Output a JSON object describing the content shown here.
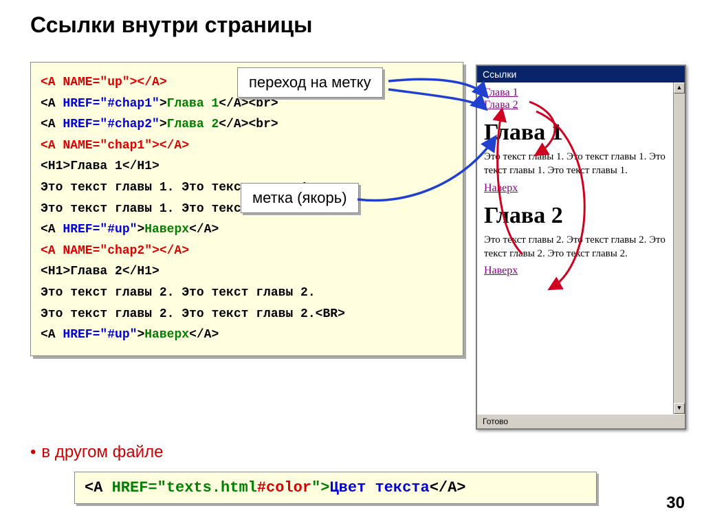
{
  "title": "Ссылки внутри страницы",
  "callout1": "переход на метку",
  "callout2": "метка (якорь)",
  "code": {
    "l1": {
      "a": "<A ",
      "b": "NAME=\"up\"",
      "c": "></A>"
    },
    "l2": {
      "a": "<A ",
      "b": "HREF=\"#chap1\"",
      "c": ">",
      "d": "Глава 1",
      "e": "</A><br>"
    },
    "l3": {
      "a": "<A ",
      "b": "HREF=\"#chap2\"",
      "c": ">",
      "d": "Глава 2",
      "e": "</A><br>"
    },
    "l4": {
      "a": "<A ",
      "b": "NAME=\"chap1\"",
      "c": "></A>"
    },
    "l5": "<H1>Глава 1</H1>",
    "l6": "Это текст главы 1. Это текст главы 1.",
    "l7": "Это текст главы 1. Это текст главы 1.<BR>",
    "l8": {
      "a": "<A ",
      "b": "HREF=\"#up\"",
      "c": ">",
      "d": "Наверх",
      "e": "</A>"
    },
    "l9": {
      "a": "<A ",
      "b": "NAME=\"chap2\"",
      "c": "></A>"
    },
    "l10": "<H1>Глава 2</H1>",
    "l11": "Это текст главы 2. Это текст главы 2.",
    "l12": "Это текст главы 2. Это текст главы 2.<BR>",
    "l13": {
      "a": "<A ",
      "b": "HREF=\"#up\"",
      "c": ">",
      "d": "Наверх",
      "e": "</A>"
    }
  },
  "other_file_label": "в другом файле",
  "bottom_code": {
    "a": "<A ",
    "b": "HREF=\"texts.html",
    "c": "#color",
    "d": "\">",
    "e": "Цвет текста",
    "f": "</A>"
  },
  "browser": {
    "title": "Ссылки",
    "link1": "Глава 1",
    "link2": "Глава 2",
    "h1_1": "Глава 1",
    "p1": "Это текст главы 1. Это текст главы 1. Это текст главы 1. Это текст главы 1.",
    "nav1": "Наверх",
    "h1_2": "Глава 2",
    "p2": "Это текст главы 2. Это текст главы 2. Это текст главы 2. Это текст главы 2.",
    "nav2": "Наверх",
    "status": "Готово"
  },
  "pagenum": "30"
}
